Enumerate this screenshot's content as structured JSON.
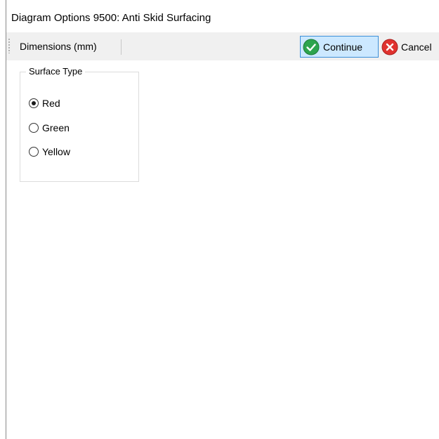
{
  "window": {
    "title": "Diagram Options 9500: Anti Skid Surfacing"
  },
  "toolbar": {
    "dimensions_label": "Dimensions (mm)",
    "continue_label": "Continue",
    "cancel_label": "Cancel",
    "continue_icon": "check-circle-icon",
    "cancel_icon": "x-circle-icon",
    "continue_icon_color": "#2da44e",
    "cancel_icon_color": "#e0322f",
    "continue_highlight_color": "#cce8ff"
  },
  "surface_type": {
    "legend": "Surface Type",
    "options": [
      {
        "label": "Red",
        "checked": true
      },
      {
        "label": "Green",
        "checked": false
      },
      {
        "label": "Yellow",
        "checked": false
      }
    ]
  }
}
